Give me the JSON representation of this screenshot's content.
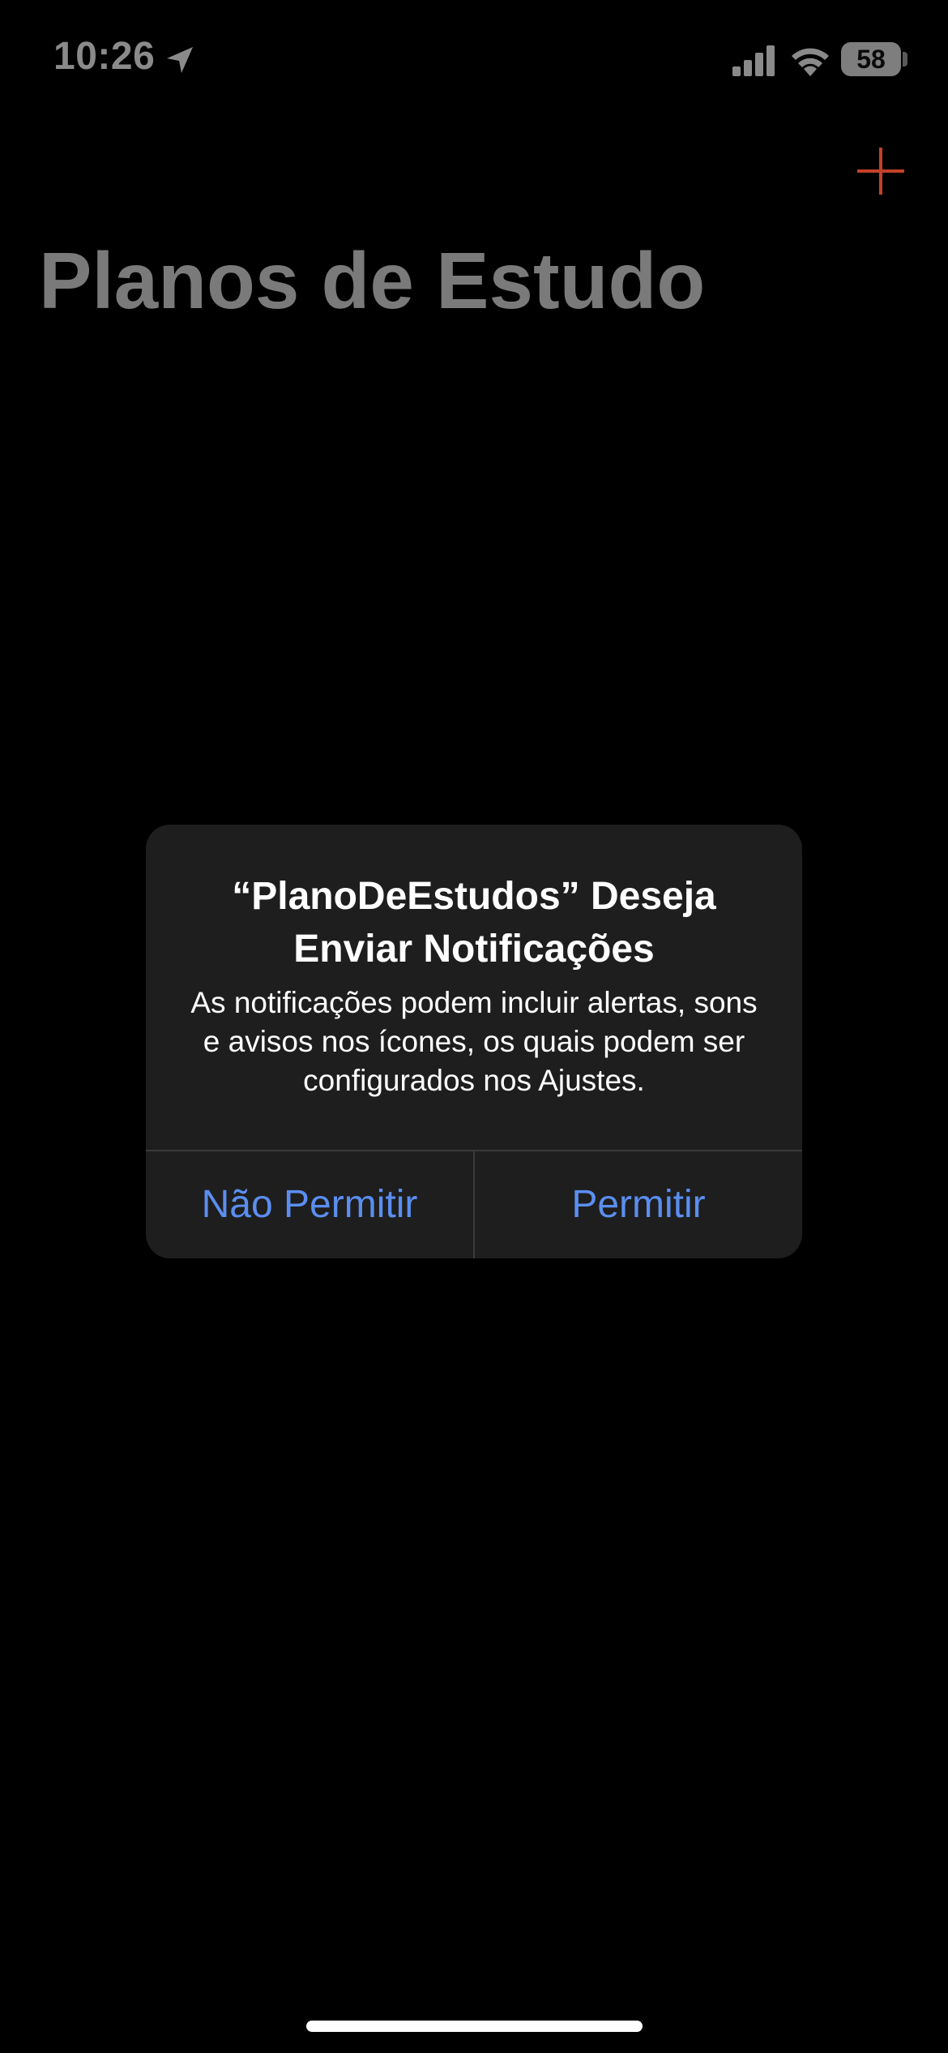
{
  "status_bar": {
    "time": "10:26",
    "battery_level": "58",
    "icons": [
      "location-arrow-icon",
      "cellular-signal-icon",
      "wifi-icon",
      "battery-icon"
    ]
  },
  "nav": {
    "add_icon": "plus-icon",
    "add_color": "#c4412a",
    "title": "Planos de Estudo"
  },
  "alert": {
    "title": "“PlanoDeEstudos” Deseja Enviar Notificações",
    "message": "As notificações podem incluir alertas, sons e avisos nos ícones, os quais podem ser configurados nos Ajustes.",
    "deny_label": "Não Permitir",
    "allow_label": "Permitir",
    "button_color": "#5b8ef0"
  }
}
